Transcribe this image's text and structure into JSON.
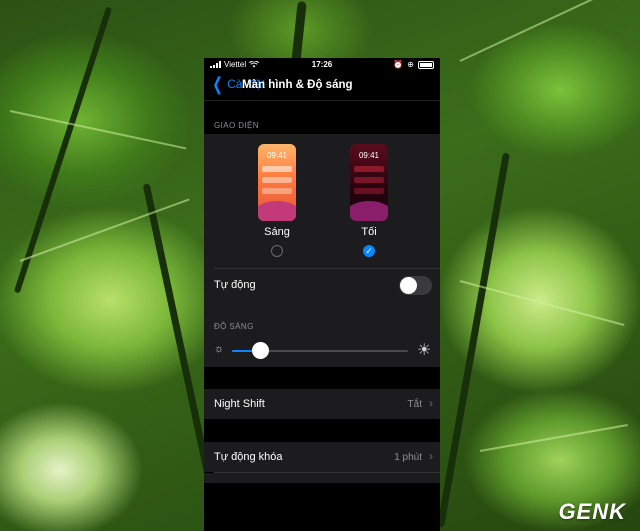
{
  "status_bar": {
    "carrier": "Viettel",
    "time": "17:26",
    "icons": [
      "signal-icon",
      "wifi-icon",
      "alarm-icon",
      "lock-rotation-icon",
      "battery-icon"
    ]
  },
  "navbar": {
    "back_label": "Cài đặt",
    "title": "Màn hình & Độ sáng"
  },
  "appearance": {
    "header": "GIAO DIỆN",
    "modes": [
      {
        "label": "Sáng",
        "preview_time": "09:41",
        "selected": false
      },
      {
        "label": "Tối",
        "preview_time": "09:41",
        "selected": true
      }
    ],
    "automatic_label": "Tự động",
    "automatic_on": false
  },
  "brightness": {
    "header": "ĐỘ SÁNG",
    "level": 0.16
  },
  "rows": [
    {
      "label": "Night Shift",
      "value": "Tắt"
    },
    {
      "label": "Tự động khóa",
      "value": "1 phút"
    }
  ],
  "watermark": "GENK",
  "colors": {
    "accent": "#0a84ff",
    "cell_bg": "#1c1c1e",
    "secondary_text": "#8e8e93"
  }
}
